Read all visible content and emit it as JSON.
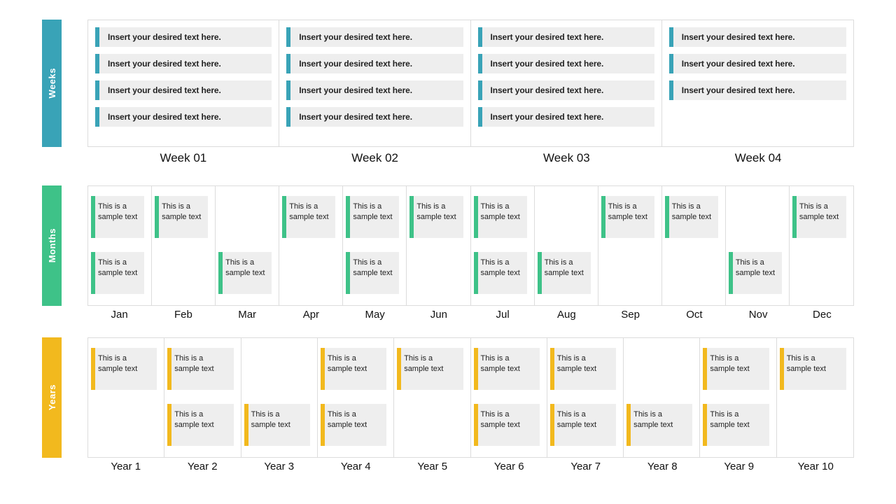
{
  "labels": {
    "weeks": "Weeks",
    "months": "Months",
    "years": "Years"
  },
  "weeks": {
    "item_text": "Insert your desired text here.",
    "columns": [
      {
        "label": "Week 01",
        "count": 4
      },
      {
        "label": "Week 02",
        "count": 4
      },
      {
        "label": "Week 03",
        "count": 4
      },
      {
        "label": "Week 04",
        "count": 3
      }
    ]
  },
  "months": {
    "card_text": "This is a sample text",
    "columns": [
      {
        "label": "Jan",
        "top": true,
        "bot": true
      },
      {
        "label": "Feb",
        "top": true,
        "bot": false
      },
      {
        "label": "Mar",
        "top": false,
        "bot": true
      },
      {
        "label": "Apr",
        "top": true,
        "bot": false
      },
      {
        "label": "May",
        "top": true,
        "bot": true
      },
      {
        "label": "Jun",
        "top": true,
        "bot": false
      },
      {
        "label": "Jul",
        "top": true,
        "bot": true
      },
      {
        "label": "Aug",
        "top": false,
        "bot": true
      },
      {
        "label": "Sep",
        "top": true,
        "bot": false
      },
      {
        "label": "Oct",
        "top": true,
        "bot": false
      },
      {
        "label": "Nov",
        "top": false,
        "bot": true
      },
      {
        "label": "Dec",
        "top": true,
        "bot": false
      }
    ]
  },
  "years": {
    "card_text": "This is a sample text",
    "columns": [
      {
        "label": "Year 1",
        "top": true,
        "bot": false
      },
      {
        "label": "Year 2",
        "top": true,
        "bot": true
      },
      {
        "label": "Year 3",
        "top": false,
        "bot": true
      },
      {
        "label": "Year 4",
        "top": true,
        "bot": true
      },
      {
        "label": "Year 5",
        "top": true,
        "bot": false
      },
      {
        "label": "Year 6",
        "top": true,
        "bot": true
      },
      {
        "label": "Year 7",
        "top": true,
        "bot": true
      },
      {
        "label": "Year 8",
        "top": false,
        "bot": true
      },
      {
        "label": "Year 9",
        "top": true,
        "bot": true
      },
      {
        "label": "Year 10",
        "top": true,
        "bot": false
      }
    ]
  }
}
